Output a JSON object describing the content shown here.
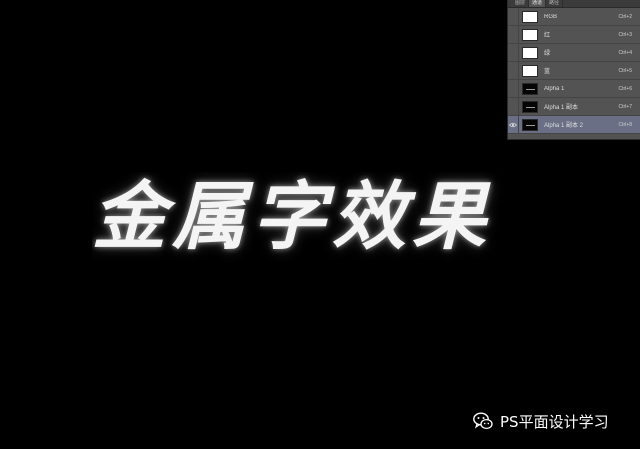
{
  "canvas": {
    "headline": "金属字效果"
  },
  "channels_panel": {
    "tabs": [
      {
        "label": "图层",
        "active": false
      },
      {
        "label": "通道",
        "active": true
      },
      {
        "label": "路径",
        "active": false
      }
    ],
    "rows": [
      {
        "name": "RGB",
        "shortcut": "Ctrl+2",
        "thumb": "white",
        "visible": false,
        "selected": false
      },
      {
        "name": "红",
        "shortcut": "Ctrl+3",
        "thumb": "white",
        "visible": false,
        "selected": false
      },
      {
        "name": "绿",
        "shortcut": "Ctrl+4",
        "thumb": "white",
        "visible": false,
        "selected": false
      },
      {
        "name": "蓝",
        "shortcut": "Ctrl+5",
        "thumb": "white",
        "visible": false,
        "selected": false
      },
      {
        "name": "Alpha 1",
        "shortcut": "Ctrl+6",
        "thumb": "black",
        "visible": false,
        "selected": false
      },
      {
        "name": "Alpha 1 副本",
        "shortcut": "Ctrl+7",
        "thumb": "black",
        "visible": false,
        "selected": false
      },
      {
        "name": "Alpha 1 副本 2",
        "shortcut": "Ctrl+8",
        "thumb": "black",
        "visible": true,
        "selected": true
      }
    ]
  },
  "watermark": {
    "text": "PS平面设计学习",
    "icon": "wechat-icon"
  },
  "colors": {
    "background": "#000000",
    "panel": "#535353",
    "selected_row": "#6a6f86"
  }
}
